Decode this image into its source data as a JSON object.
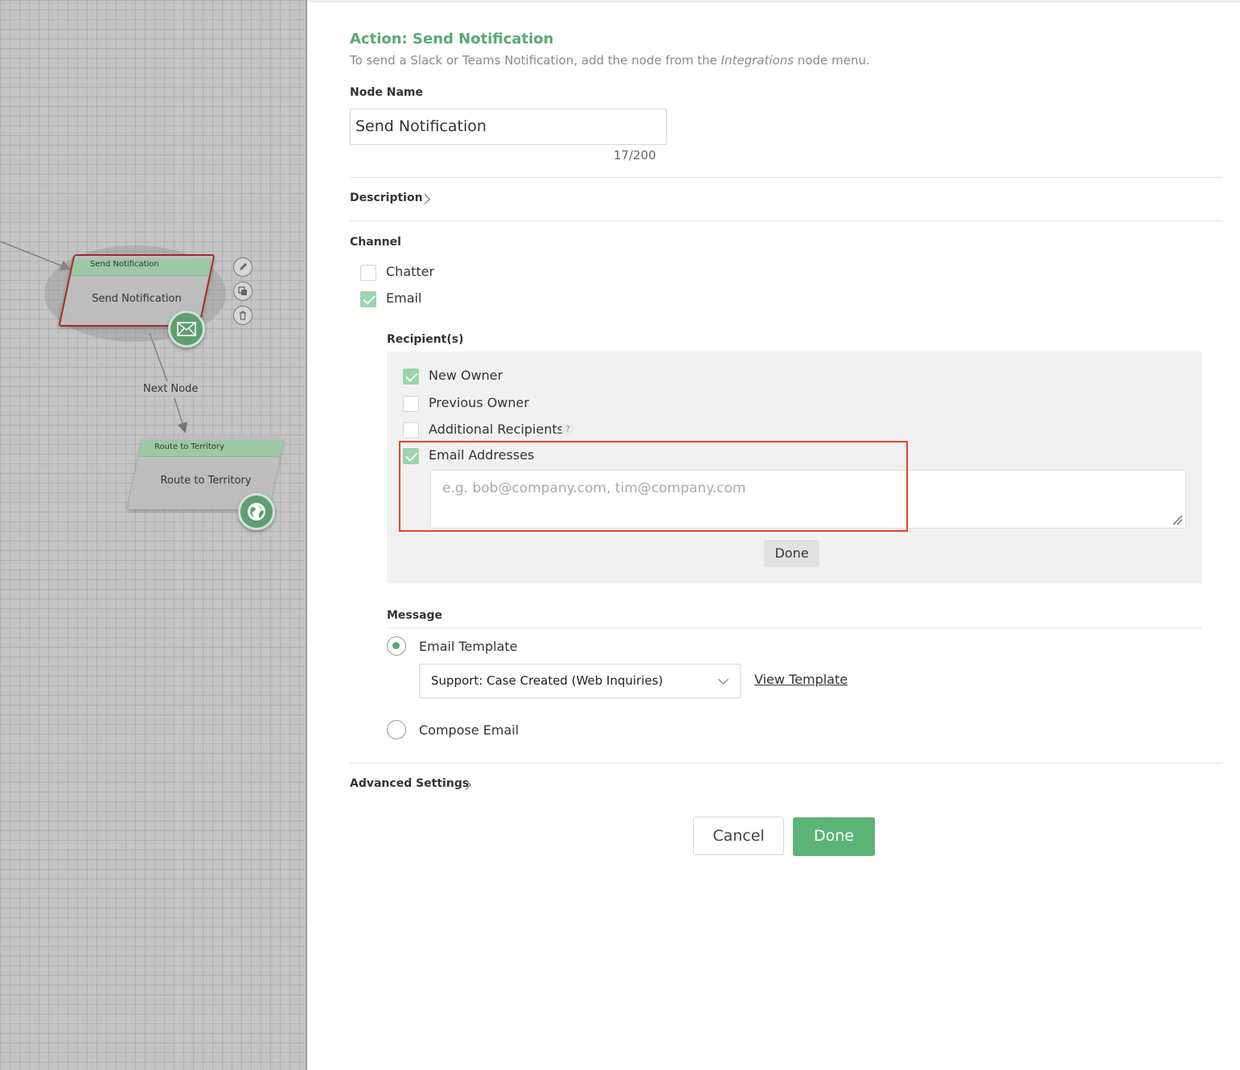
{
  "canvas": {
    "nodes": [
      {
        "header": "Send Notification",
        "label": "Send Notification",
        "icon": "envelope-icon",
        "selected": true
      },
      {
        "header": "Route to Territory",
        "label": "Route to Territory",
        "icon": "globe-icon",
        "selected": false
      }
    ],
    "edge_label": "Next Node",
    "toolbar_icons": [
      "edit-icon",
      "copy-icon",
      "delete-icon"
    ]
  },
  "panel": {
    "title": "Action: Send Notification",
    "subtitle_before": "To send a Slack or Teams Notification, add the node from the ",
    "subtitle_em": "Integrations",
    "subtitle_after": " node menu.",
    "node_name_label": "Node Name",
    "node_name_value": "Send Notification",
    "node_name_counter": "17/200",
    "description_label": "Description",
    "channel_label": "Channel",
    "channels": [
      {
        "label": "Chatter",
        "checked": false
      },
      {
        "label": "Email",
        "checked": true
      }
    ],
    "recipients_label": "Recipient(s)",
    "recipients": [
      {
        "label": "New Owner",
        "checked": true
      },
      {
        "label": "Previous Owner",
        "checked": false
      },
      {
        "label": "Additional Recipients",
        "checked": false,
        "help": "?"
      },
      {
        "label": "Email Addresses",
        "checked": true
      }
    ],
    "email_addresses_placeholder": "e.g. bob@company.com, tim@company.com",
    "recipients_done": "Done",
    "message_label": "Message",
    "message_options": [
      {
        "label": "Email Template",
        "selected": true
      },
      {
        "label": "Compose Email",
        "selected": false
      }
    ],
    "template_selected": "Support: Case Created (Web Inquiries)",
    "view_template": "View Template",
    "advanced_settings": "Advanced Settings",
    "cancel": "Cancel",
    "done": "Done"
  },
  "colors": {
    "accent": "#5aa873",
    "check": "#9bd4ad",
    "highlight": "#e5422b",
    "primary_button": "#5bb375"
  }
}
